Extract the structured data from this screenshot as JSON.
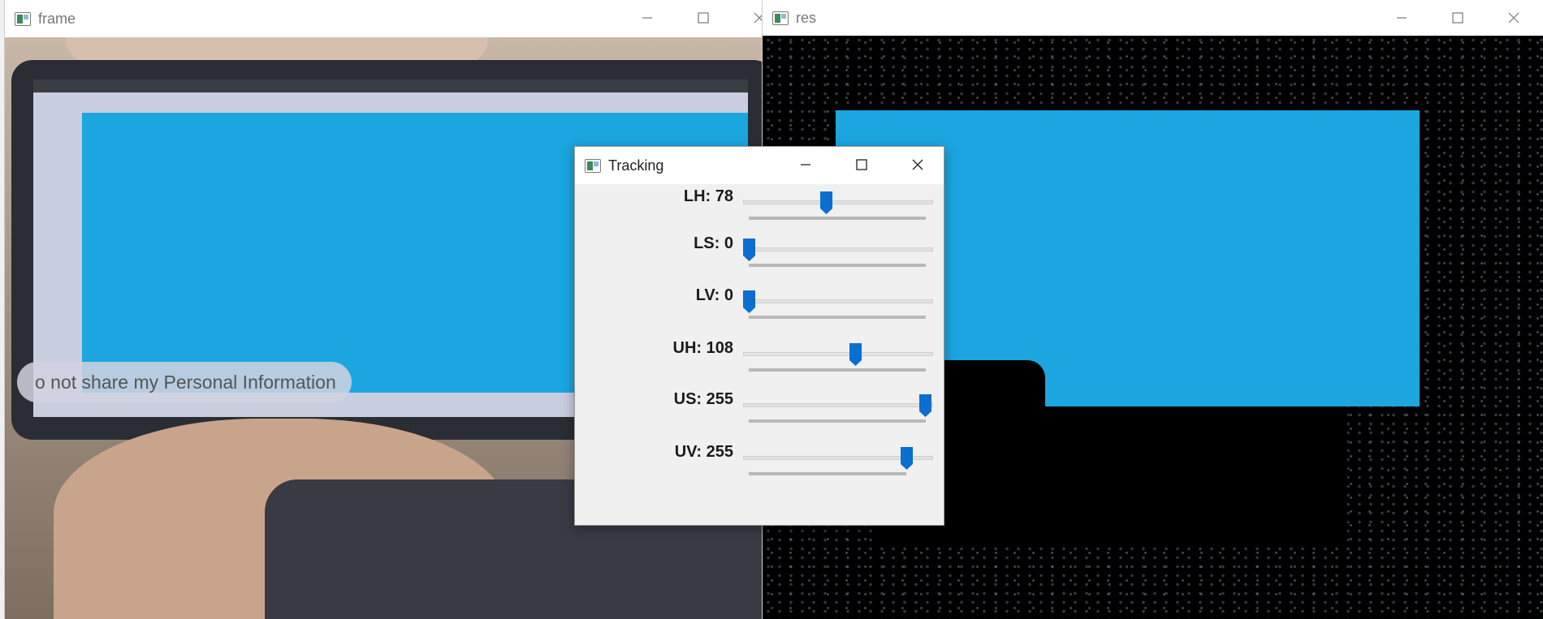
{
  "windows": {
    "frame": {
      "title": "frame"
    },
    "res": {
      "title": "res"
    },
    "tracking": {
      "title": "Tracking"
    }
  },
  "frame_view": {
    "button_text": "o not share my Personal Information"
  },
  "trackbars": [
    {
      "label": "LH: 78",
      "value": 78,
      "max": 179
    },
    {
      "label": "LS: 0",
      "value": 0,
      "max": 255
    },
    {
      "label": "LV: 0",
      "value": 0,
      "max": 255
    },
    {
      "label": "UH: 108",
      "value": 108,
      "max": 179
    },
    {
      "label": "US: 255",
      "value": 255,
      "max": 255
    },
    {
      "label": "UV: 255",
      "value": 255,
      "max": 255
    }
  ],
  "colors": {
    "accent": "#0a6fd0",
    "cyan": "#1ba6df"
  },
  "icons": {
    "app": "opencv-window-icon",
    "minimize": "minimize-icon",
    "maximize": "maximize-icon",
    "close": "close-icon"
  }
}
